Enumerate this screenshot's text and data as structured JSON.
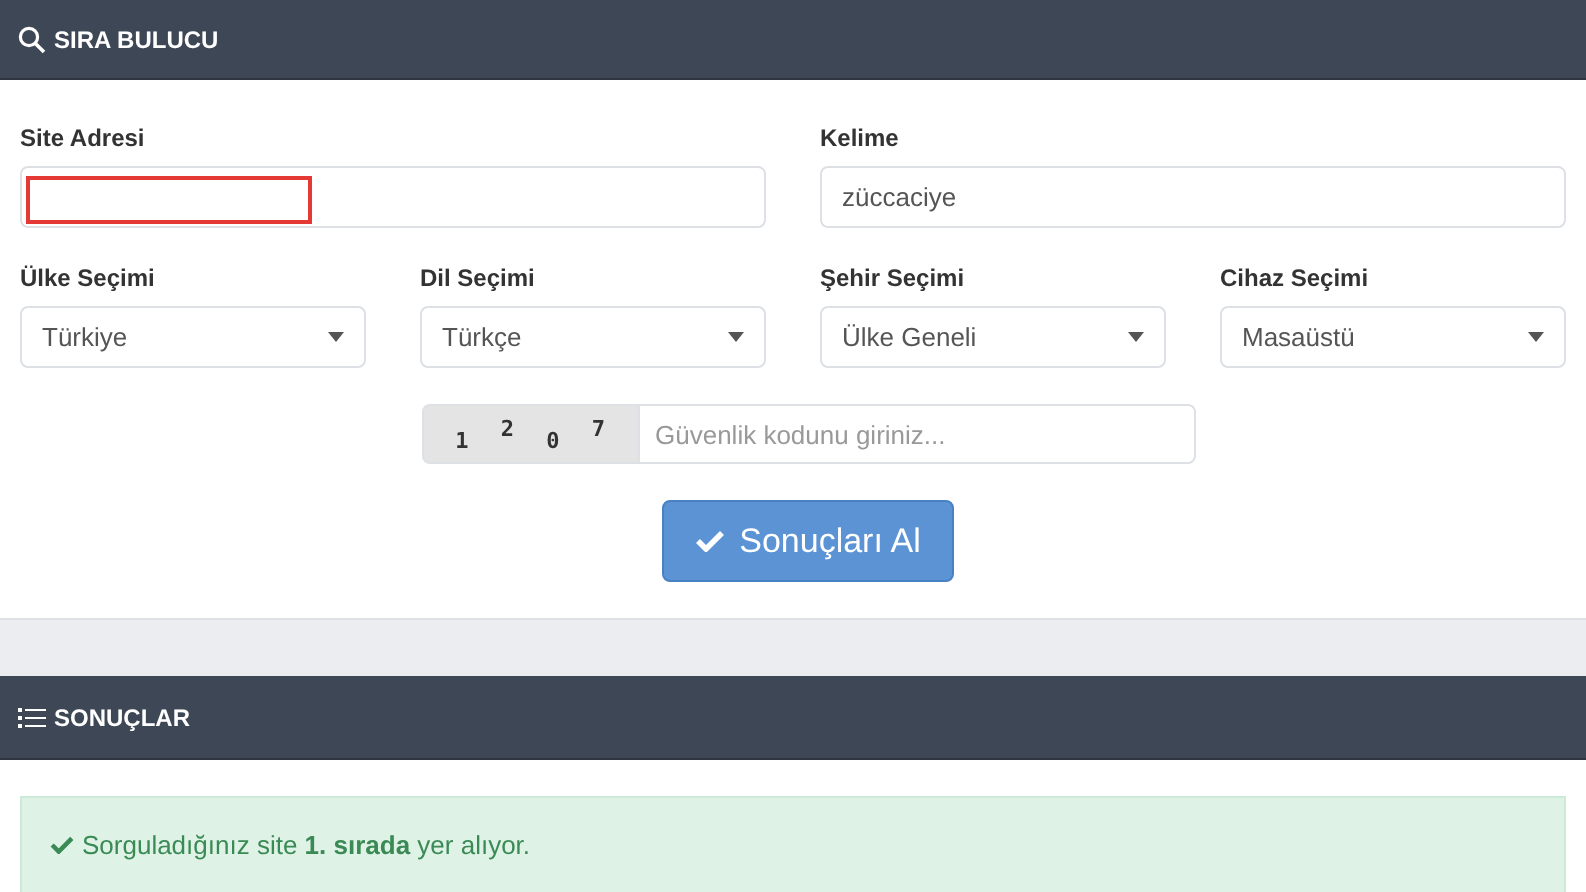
{
  "search_panel": {
    "title": "SIRA BULUCU",
    "text_fields": [
      {
        "label": "Site Adresi",
        "highlighted": true
      },
      {
        "label": "Kelime",
        "value": "züccaciye",
        "highlighted": false
      }
    ],
    "selects": [
      {
        "label": "Ülke Seçimi",
        "value": "Türkiye"
      },
      {
        "label": "Dil Seçimi",
        "value": "Türkçe"
      },
      {
        "label": "Şehir Seçimi",
        "value": "Ülke Geneli"
      },
      {
        "label": "Cihaz Seçimi",
        "value": "Masaüstü"
      }
    ],
    "captcha": {
      "digits": [
        "1",
        "2",
        "0",
        "7"
      ],
      "placeholder": "Güvenlik kodunu giriniz..."
    },
    "submit_button": "Sonuçları Al"
  },
  "results_panel": {
    "title": "SONUÇLAR",
    "alert": "Sorguladığınız site **1. sırada** yer alıyor."
  }
}
